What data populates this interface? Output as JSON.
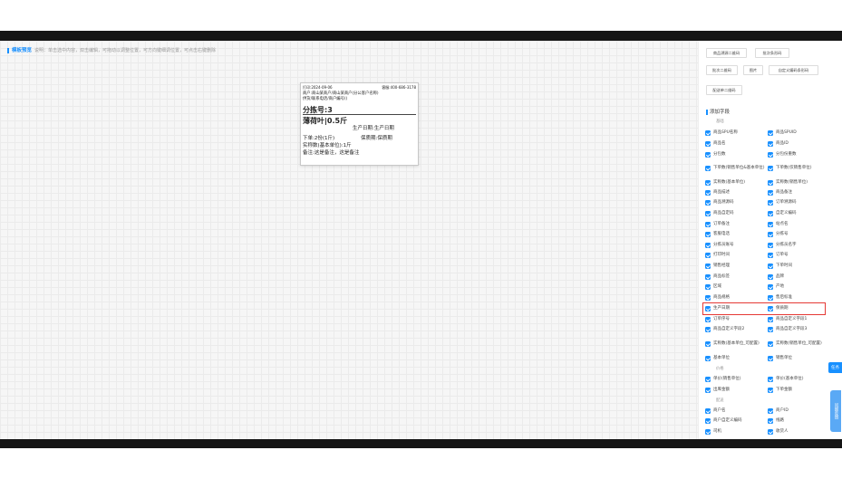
{
  "preview": {
    "title": "模板预览",
    "hint": "说明：单击选中内容，双击编辑，可拖动以调整位置，可方向键细调位置，可点击右键删除"
  },
  "label": {
    "print_time": "打印:2024-09-06",
    "phone": "客服:400-686-3178",
    "merchant_line": "商户:商山某商户/商山某商户(分公客户名称)",
    "address_line": "供货/联系电话/商户编号()",
    "sort_no": "分拣号:3",
    "product": "薄荷叶|0.5斤",
    "dates": "生产日期:生产日期",
    "order_qty": "下单:2份(1斤)",
    "shelf_life": "保质期:保质期",
    "actual_qty": "实称数(基本单位):1斤",
    "remark": "备注:这是备注，这是备注"
  },
  "sidebar": {
    "buttons": [
      "商品溯源二维码",
      "批次条形码",
      "批次二维码",
      "图片",
      "自定义编码条形码",
      "配送单二维码"
    ],
    "section_title": "添加字段",
    "groups": [
      "基础",
      "价格",
      "配送"
    ],
    "fields": [
      "商品SPU名称",
      "商品SPUID",
      "商品名",
      "商品ID",
      "分包数",
      "分包份重数",
      "下单数(销售单位&基本单位)",
      "下单数(仅销售单位)",
      "实称数(基本单位)",
      "实称数(销售单位)",
      "商品描述",
      "商品备注",
      "商品溯源码",
      "订单溯源码",
      "商品自定码",
      "自定义编码",
      "订单备注",
      "站点名",
      "客服电话",
      "分拣号",
      "分拣员账号",
      "分拣员名字",
      "打印时间",
      "订单号",
      "销售经理",
      "下单时间",
      "商品标签",
      "品牌",
      "区域",
      "产地",
      "商品规格",
      "售后标准",
      "生产日期",
      "保质期",
      "订单序号",
      "商品自定义字段1",
      "商品自定义字段2",
      "商品自定义字段3",
      "实称数(基本单位_可配置)",
      "实称数(销售单位_可配置)",
      "基本单位",
      "销售单位",
      "单价(销售单位)",
      "单价(基本单位)",
      "出库金额",
      "下单金额",
      "商户名",
      "商户ID",
      "商户自定义编码",
      "线路",
      "司机",
      "收货人"
    ]
  },
  "floating": {
    "task": "任务",
    "feedback": "问题反馈"
  }
}
